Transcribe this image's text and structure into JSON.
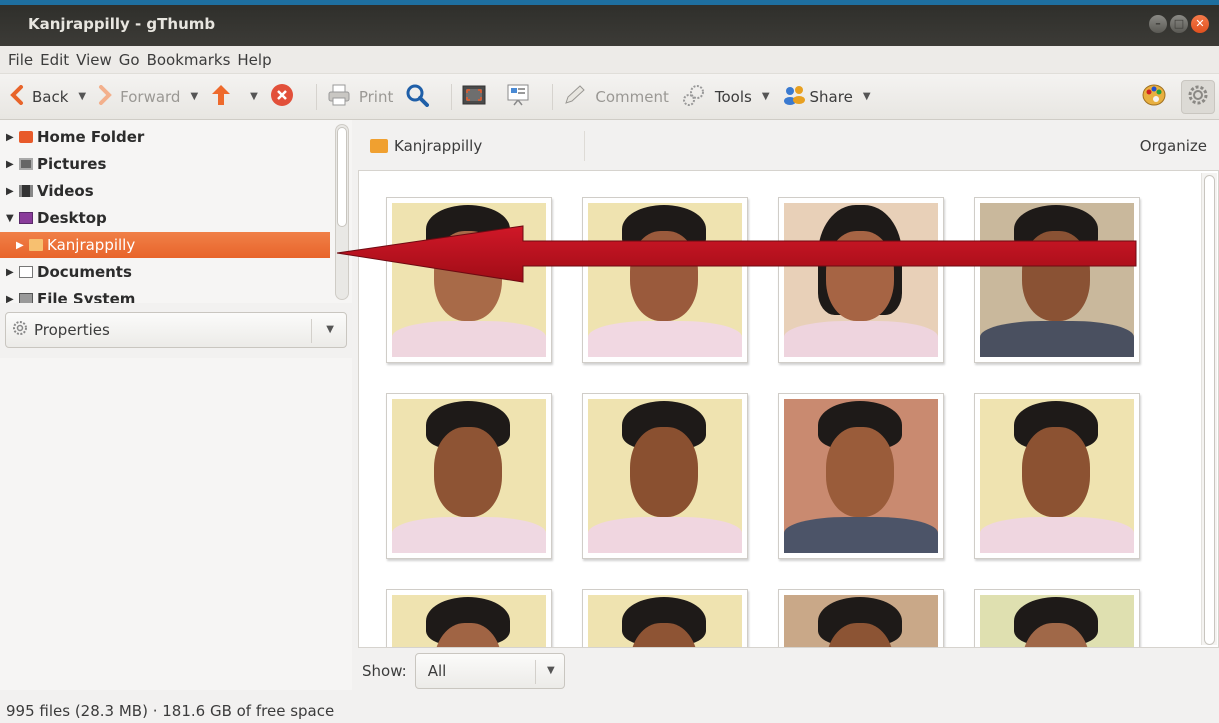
{
  "window": {
    "title": "Kanjrappilly - gThumb"
  },
  "menubar": [
    "File",
    "Edit",
    "View",
    "Go",
    "Bookmarks",
    "Help"
  ],
  "toolbar": {
    "back": "Back",
    "forward": "Forward",
    "print": "Print",
    "comment": "Comment",
    "tools": "Tools",
    "share": "Share"
  },
  "sidebar": {
    "items": [
      {
        "label": "Home Folder",
        "icon": "home-folder-icon",
        "color": "#e85a2a"
      },
      {
        "label": "Pictures",
        "icon": "pictures-folder-icon",
        "color": "#555555"
      },
      {
        "label": "Videos",
        "icon": "videos-folder-icon",
        "color": "#444444"
      },
      {
        "label": "Desktop",
        "icon": "desktop-folder-icon",
        "color": "#8a3c9a"
      },
      {
        "label": "Kanjrappilly",
        "icon": "folder-icon",
        "color": "#f0a030",
        "selected": true
      },
      {
        "label": "Documents",
        "icon": "documents-folder-icon",
        "color": "#666666"
      },
      {
        "label": "File System",
        "icon": "drive-icon",
        "color": "#777777"
      }
    ]
  },
  "properties": {
    "label": "Properties"
  },
  "pathbar": {
    "folder": "Kanjrappilly",
    "organize": "Organize"
  },
  "show": {
    "label": "Show:",
    "value": "All"
  },
  "status": {
    "text": "995 files (28.3 MB) · 181.6 GB of free space"
  },
  "colors": {
    "accent": "#e8642a",
    "arrow": "#c0101a"
  }
}
